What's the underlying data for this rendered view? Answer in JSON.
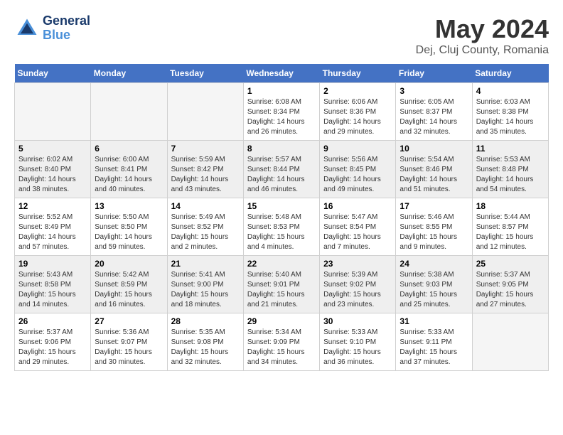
{
  "header": {
    "logo_line1": "General",
    "logo_line2": "Blue",
    "title": "May 2024",
    "subtitle": "Dej, Cluj County, Romania"
  },
  "calendar": {
    "days_of_week": [
      "Sunday",
      "Monday",
      "Tuesday",
      "Wednesday",
      "Thursday",
      "Friday",
      "Saturday"
    ],
    "weeks": [
      [
        {
          "day": "",
          "info": ""
        },
        {
          "day": "",
          "info": ""
        },
        {
          "day": "",
          "info": ""
        },
        {
          "day": "1",
          "info": "Sunrise: 6:08 AM\nSunset: 8:34 PM\nDaylight: 14 hours\nand 26 minutes."
        },
        {
          "day": "2",
          "info": "Sunrise: 6:06 AM\nSunset: 8:36 PM\nDaylight: 14 hours\nand 29 minutes."
        },
        {
          "day": "3",
          "info": "Sunrise: 6:05 AM\nSunset: 8:37 PM\nDaylight: 14 hours\nand 32 minutes."
        },
        {
          "day": "4",
          "info": "Sunrise: 6:03 AM\nSunset: 8:38 PM\nDaylight: 14 hours\nand 35 minutes."
        }
      ],
      [
        {
          "day": "5",
          "info": "Sunrise: 6:02 AM\nSunset: 8:40 PM\nDaylight: 14 hours\nand 38 minutes."
        },
        {
          "day": "6",
          "info": "Sunrise: 6:00 AM\nSunset: 8:41 PM\nDaylight: 14 hours\nand 40 minutes."
        },
        {
          "day": "7",
          "info": "Sunrise: 5:59 AM\nSunset: 8:42 PM\nDaylight: 14 hours\nand 43 minutes."
        },
        {
          "day": "8",
          "info": "Sunrise: 5:57 AM\nSunset: 8:44 PM\nDaylight: 14 hours\nand 46 minutes."
        },
        {
          "day": "9",
          "info": "Sunrise: 5:56 AM\nSunset: 8:45 PM\nDaylight: 14 hours\nand 49 minutes."
        },
        {
          "day": "10",
          "info": "Sunrise: 5:54 AM\nSunset: 8:46 PM\nDaylight: 14 hours\nand 51 minutes."
        },
        {
          "day": "11",
          "info": "Sunrise: 5:53 AM\nSunset: 8:48 PM\nDaylight: 14 hours\nand 54 minutes."
        }
      ],
      [
        {
          "day": "12",
          "info": "Sunrise: 5:52 AM\nSunset: 8:49 PM\nDaylight: 14 hours\nand 57 minutes."
        },
        {
          "day": "13",
          "info": "Sunrise: 5:50 AM\nSunset: 8:50 PM\nDaylight: 14 hours\nand 59 minutes."
        },
        {
          "day": "14",
          "info": "Sunrise: 5:49 AM\nSunset: 8:52 PM\nDaylight: 15 hours\nand 2 minutes."
        },
        {
          "day": "15",
          "info": "Sunrise: 5:48 AM\nSunset: 8:53 PM\nDaylight: 15 hours\nand 4 minutes."
        },
        {
          "day": "16",
          "info": "Sunrise: 5:47 AM\nSunset: 8:54 PM\nDaylight: 15 hours\nand 7 minutes."
        },
        {
          "day": "17",
          "info": "Sunrise: 5:46 AM\nSunset: 8:55 PM\nDaylight: 15 hours\nand 9 minutes."
        },
        {
          "day": "18",
          "info": "Sunrise: 5:44 AM\nSunset: 8:57 PM\nDaylight: 15 hours\nand 12 minutes."
        }
      ],
      [
        {
          "day": "19",
          "info": "Sunrise: 5:43 AM\nSunset: 8:58 PM\nDaylight: 15 hours\nand 14 minutes."
        },
        {
          "day": "20",
          "info": "Sunrise: 5:42 AM\nSunset: 8:59 PM\nDaylight: 15 hours\nand 16 minutes."
        },
        {
          "day": "21",
          "info": "Sunrise: 5:41 AM\nSunset: 9:00 PM\nDaylight: 15 hours\nand 18 minutes."
        },
        {
          "day": "22",
          "info": "Sunrise: 5:40 AM\nSunset: 9:01 PM\nDaylight: 15 hours\nand 21 minutes."
        },
        {
          "day": "23",
          "info": "Sunrise: 5:39 AM\nSunset: 9:02 PM\nDaylight: 15 hours\nand 23 minutes."
        },
        {
          "day": "24",
          "info": "Sunrise: 5:38 AM\nSunset: 9:03 PM\nDaylight: 15 hours\nand 25 minutes."
        },
        {
          "day": "25",
          "info": "Sunrise: 5:37 AM\nSunset: 9:05 PM\nDaylight: 15 hours\nand 27 minutes."
        }
      ],
      [
        {
          "day": "26",
          "info": "Sunrise: 5:37 AM\nSunset: 9:06 PM\nDaylight: 15 hours\nand 29 minutes."
        },
        {
          "day": "27",
          "info": "Sunrise: 5:36 AM\nSunset: 9:07 PM\nDaylight: 15 hours\nand 30 minutes."
        },
        {
          "day": "28",
          "info": "Sunrise: 5:35 AM\nSunset: 9:08 PM\nDaylight: 15 hours\nand 32 minutes."
        },
        {
          "day": "29",
          "info": "Sunrise: 5:34 AM\nSunset: 9:09 PM\nDaylight: 15 hours\nand 34 minutes."
        },
        {
          "day": "30",
          "info": "Sunrise: 5:33 AM\nSunset: 9:10 PM\nDaylight: 15 hours\nand 36 minutes."
        },
        {
          "day": "31",
          "info": "Sunrise: 5:33 AM\nSunset: 9:11 PM\nDaylight: 15 hours\nand 37 minutes."
        },
        {
          "day": "",
          "info": ""
        }
      ]
    ]
  }
}
